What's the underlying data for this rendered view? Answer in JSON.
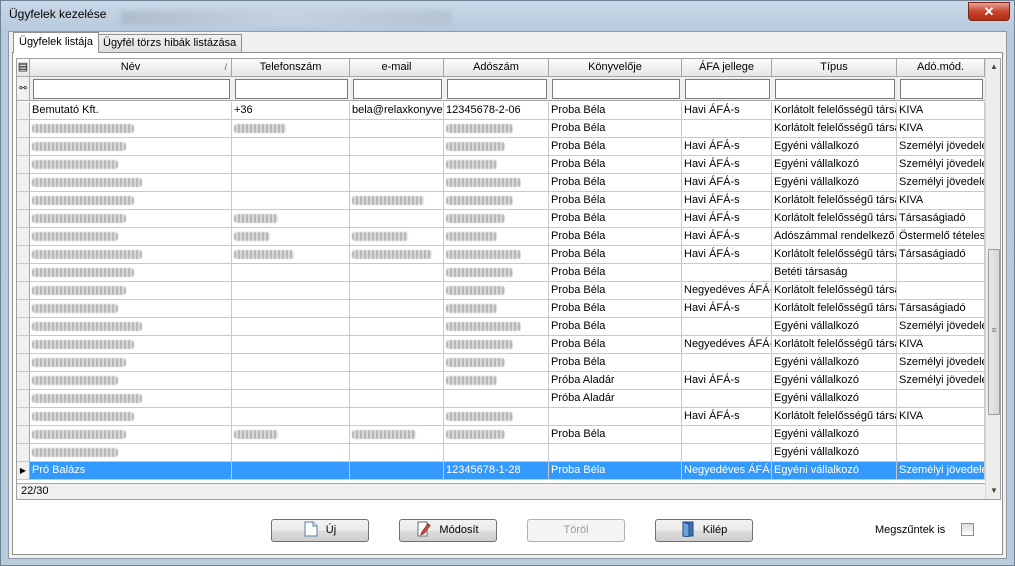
{
  "window": {
    "title": "Ügyfelek kezelése",
    "close_label": "✕"
  },
  "tabs": [
    {
      "label": "Ügyfelek listája",
      "active": true
    },
    {
      "label": "Ügyfél törzs hibák listázása",
      "active": false
    }
  ],
  "grid": {
    "columns": [
      {
        "label": "Név"
      },
      {
        "label": "Telefonszám"
      },
      {
        "label": "e-mail"
      },
      {
        "label": "Adószám"
      },
      {
        "label": "Könyvelője"
      },
      {
        "label": "ÁFA jellege"
      },
      {
        "label": "Típus"
      },
      {
        "label": "Adó.mód."
      }
    ],
    "sort_icon": "/",
    "rows": [
      {
        "nev": "Bemutató Kft.",
        "tel": "+36",
        "email": "bela@relaxkonyvel",
        "adoszam": "12345678-2-06",
        "konyvelo": "Proba Béla",
        "afa": "Havi ÁFÁ-s",
        "tipus": "Korlátolt felelősségű társa",
        "adomod": "KIVA",
        "selected": false
      },
      {
        "nev": "",
        "tel": "",
        "email": "",
        "adoszam": "",
        "konyvelo": "Proba Béla",
        "afa": "",
        "tipus": "Korlátolt felelősségű társa",
        "adomod": "KIVA",
        "selected": false
      },
      {
        "nev": "",
        "tel": "",
        "email": "",
        "adoszam": "",
        "konyvelo": "Proba Béla",
        "afa": "Havi ÁFÁ-s",
        "tipus": "Egyéni vállalkozó",
        "adomod": "Személyi jövedelema",
        "selected": false
      },
      {
        "nev": "",
        "tel": "",
        "email": "",
        "adoszam": "",
        "konyvelo": "Proba Béla",
        "afa": "Havi ÁFÁ-s",
        "tipus": "Egyéni vállalkozó",
        "adomod": "Személyi jövedelema",
        "selected": false
      },
      {
        "nev": "",
        "tel": "",
        "email": "",
        "adoszam": "",
        "konyvelo": "Proba Béla",
        "afa": "Havi ÁFÁ-s",
        "tipus": "Egyéni vállalkozó",
        "adomod": "Személyi jövedelema",
        "selected": false
      },
      {
        "nev": "",
        "tel": "",
        "email": "",
        "adoszam": "",
        "konyvelo": "Proba Béla",
        "afa": "Havi ÁFÁ-s",
        "tipus": "Korlátolt felelősségű társa",
        "adomod": "KIVA",
        "selected": false
      },
      {
        "nev": "",
        "tel": "",
        "email": "",
        "adoszam": "",
        "konyvelo": "Proba Béla",
        "afa": "Havi ÁFÁ-s",
        "tipus": "Korlátolt felelősségű társa",
        "adomod": "Társaságiadó",
        "selected": false
      },
      {
        "nev": "",
        "tel": "",
        "email": "",
        "adoszam": "",
        "konyvelo": "Proba Béla",
        "afa": "Havi ÁFÁ-s",
        "tipus": "Adószámmal rendelkező m",
        "adomod": "Östermelő tételes",
        "selected": false
      },
      {
        "nev": "",
        "tel": "",
        "email": "",
        "adoszam": "",
        "konyvelo": "Proba Béla",
        "afa": "Havi ÁFÁ-s",
        "tipus": "Korlátolt felelősségű társa",
        "adomod": "Társaságiadó",
        "selected": false
      },
      {
        "nev": "",
        "tel": "",
        "email": "",
        "adoszam": "",
        "konyvelo": "Proba Béla",
        "afa": "",
        "tipus": "Betéti társaság",
        "adomod": "",
        "selected": false
      },
      {
        "nev": "",
        "tel": "",
        "email": "",
        "adoszam": "",
        "konyvelo": "Proba Béla",
        "afa": "Negyedéves ÁFÁ-",
        "tipus": "Korlátolt felelősségű társa",
        "adomod": "",
        "selected": false
      },
      {
        "nev": "",
        "tel": "",
        "email": "",
        "adoszam": "",
        "konyvelo": "Proba Béla",
        "afa": "Havi ÁFÁ-s",
        "tipus": "Korlátolt felelősségű társa",
        "adomod": "Társaságiadó",
        "selected": false
      },
      {
        "nev": "",
        "tel": "",
        "email": "",
        "adoszam": "",
        "konyvelo": "Proba Béla",
        "afa": "",
        "tipus": "Egyéni vállalkozó",
        "adomod": "Személyi jövedelema",
        "selected": false
      },
      {
        "nev": "",
        "tel": "",
        "email": "",
        "adoszam": "",
        "konyvelo": "Proba Béla",
        "afa": "Negyedéves ÁFÁ-",
        "tipus": "Korlátolt felelősségű társa",
        "adomod": "KIVA",
        "selected": false
      },
      {
        "nev": "",
        "tel": "",
        "email": "",
        "adoszam": "",
        "konyvelo": "Proba Béla",
        "afa": "",
        "tipus": "Egyéni vállalkozó",
        "adomod": "Személyi jövedelema",
        "selected": false
      },
      {
        "nev": "",
        "tel": "",
        "email": "",
        "adoszam": "",
        "konyvelo": "Próba Aladár",
        "afa": "Havi ÁFÁ-s",
        "tipus": "Egyéni vállalkozó",
        "adomod": "Személyi jövedelema",
        "selected": false
      },
      {
        "nev": "",
        "tel": "",
        "email": "",
        "adoszam": "",
        "konyvelo": "Próba Aladár",
        "afa": "",
        "tipus": "Egyéni vállalkozó",
        "adomod": "",
        "selected": false
      },
      {
        "nev": "",
        "tel": "",
        "email": "",
        "adoszam": "",
        "konyvelo": "",
        "afa": "Havi ÁFÁ-s",
        "tipus": "Korlátolt felelősségű társa",
        "adomod": "KIVA",
        "selected": false
      },
      {
        "nev": "",
        "tel": "",
        "email": "",
        "adoszam": "",
        "konyvelo": "Proba Béla",
        "afa": "",
        "tipus": "Egyéni vállalkozó",
        "adomod": "",
        "selected": false
      },
      {
        "nev": "",
        "tel": "",
        "email": "",
        "adoszam": "",
        "konyvelo": "",
        "afa": "",
        "tipus": "Egyéni vállalkozó",
        "adomod": "",
        "selected": false
      },
      {
        "nev": "Pró Balázs",
        "tel": "",
        "email": "",
        "adoszam": "12345678-1-28",
        "konyvelo": "Proba Béla",
        "afa": "Negyedéves ÁFÁ-",
        "tipus": "Egyéni vállalkozó",
        "adomod": "Személyi jövedelema",
        "selected": true
      }
    ],
    "status_text": "22/30"
  },
  "buttons": {
    "new_label": "Új",
    "edit_label": "Módosít",
    "delete_label": "Töröl",
    "exit_label": "Kilép"
  },
  "options": {
    "terminated_label": "Megszűntek is",
    "terminated_checked": false
  }
}
